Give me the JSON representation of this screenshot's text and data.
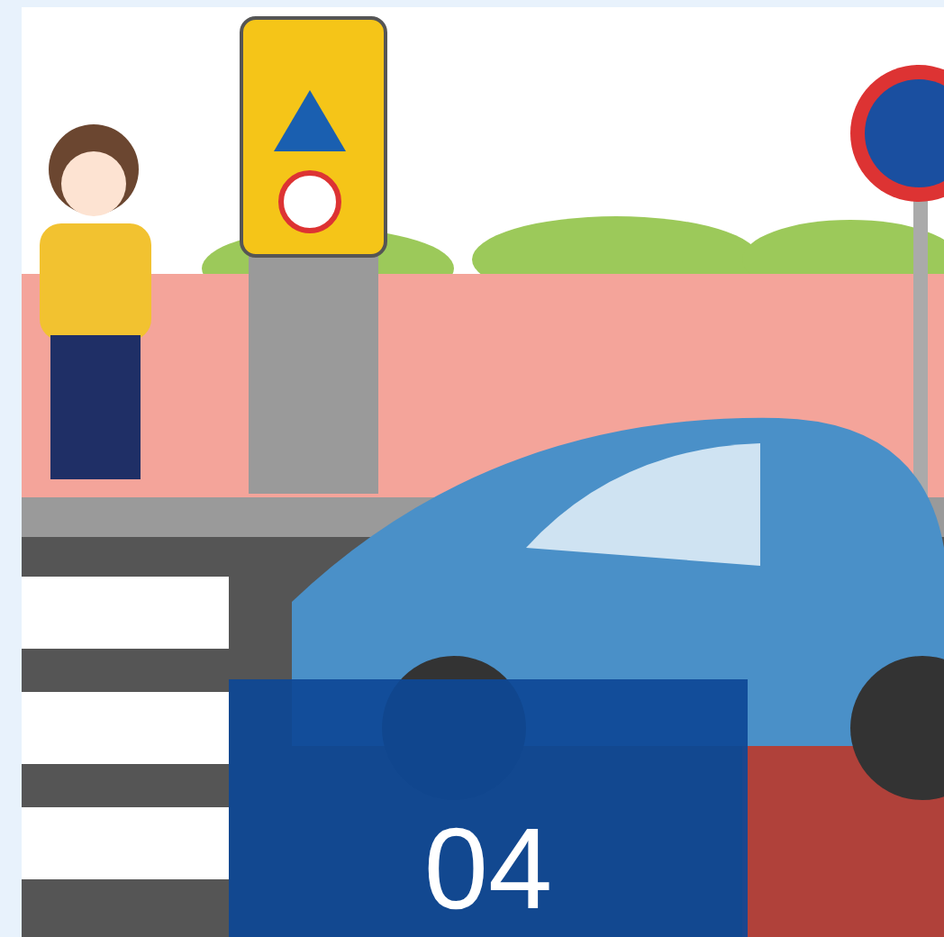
{
  "card": {
    "number": "04"
  }
}
